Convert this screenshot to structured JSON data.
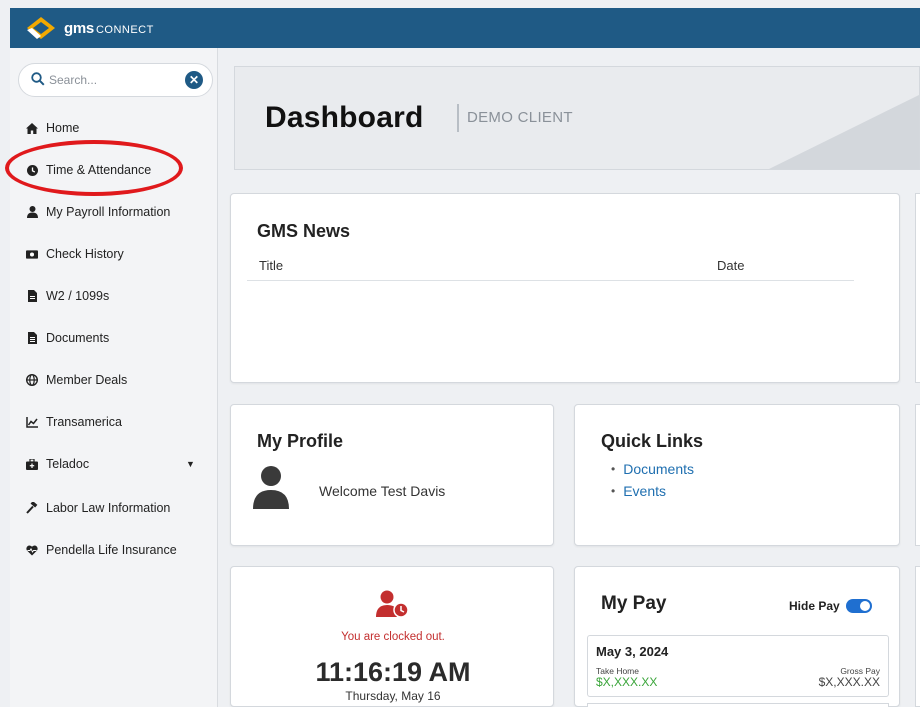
{
  "app": {
    "brand_name": "gms",
    "brand_suffix": "CONNECT",
    "brand_color": "#1f5a85"
  },
  "sidebar": {
    "search": {
      "placeholder": "Search...",
      "value": ""
    },
    "items": [
      {
        "label": "Home",
        "icon": "home-icon"
      },
      {
        "label": "Time & Attendance",
        "icon": "clock-icon"
      },
      {
        "label": "My Payroll Information",
        "icon": "user-icon"
      },
      {
        "label": "Check History",
        "icon": "money-icon"
      },
      {
        "label": "W2 / 1099s",
        "icon": "file-icon"
      },
      {
        "label": "Documents",
        "icon": "document-icon"
      },
      {
        "label": "Member Deals",
        "icon": "globe-icon"
      },
      {
        "label": "Transamerica",
        "icon": "chart-line-icon"
      },
      {
        "label": "Teladoc",
        "icon": "medical-bag-icon",
        "has_submenu": true
      },
      {
        "label": "Labor Law Information",
        "icon": "gavel-icon"
      },
      {
        "label": "Pendella Life Insurance",
        "icon": "heartbeat-icon"
      }
    ],
    "highlighted_item": "Time & Attendance",
    "highlight_color": "#e0191c"
  },
  "header": {
    "title": "Dashboard",
    "client": "DEMO CLIENT"
  },
  "news": {
    "title": "GMS News",
    "columns": [
      "Title",
      "Date"
    ],
    "rows": []
  },
  "profile": {
    "title": "My Profile",
    "welcome": "Welcome Test Davis"
  },
  "quick_links": {
    "title": "Quick Links",
    "links": [
      "Documents",
      "Events"
    ]
  },
  "clock": {
    "status": "You are clocked out.",
    "time": "11:16:19 AM",
    "date": "Thursday, May 16",
    "status_color": "#c32f2f"
  },
  "pay": {
    "title": "My Pay",
    "hide_label": "Hide Pay",
    "hide_enabled": true,
    "entries": [
      {
        "date": "May 3, 2024",
        "take_home_label": "Take Home",
        "take_home": "$X,XXX.XX",
        "gross_label": "Gross Pay",
        "gross": "$X,XXX.XX"
      }
    ]
  }
}
